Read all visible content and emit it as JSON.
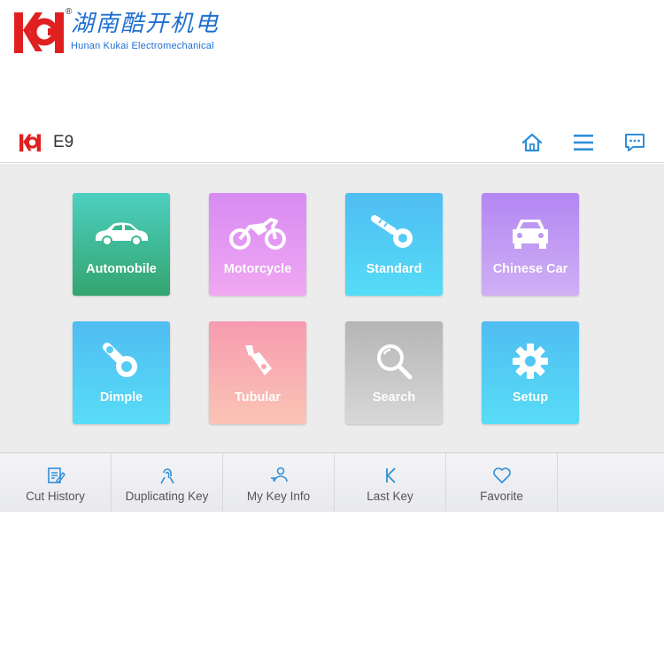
{
  "brand": {
    "name_cn": "湖南酷开机电",
    "name_en": "Hunan Kukai Electromechanical",
    "registered": "®"
  },
  "header": {
    "title": "E9",
    "icons": [
      "home-icon",
      "menu-icon",
      "message-icon"
    ],
    "accent_color": "#2f8fd8"
  },
  "tiles": [
    {
      "label": "Automobile",
      "icon": "car-side-icon"
    },
    {
      "label": "Motorcycle",
      "icon": "motorcycle-icon"
    },
    {
      "label": "Standard",
      "icon": "standard-key-icon"
    },
    {
      "label": "Chinese Car",
      "icon": "car-front-icon"
    },
    {
      "label": "Dimple",
      "icon": "dimple-key-icon"
    },
    {
      "label": "Tubular",
      "icon": "tubular-key-icon"
    },
    {
      "label": "Search",
      "icon": "magnifier-icon"
    },
    {
      "label": "Setup",
      "icon": "gear-icon"
    }
  ],
  "bottom_nav": [
    {
      "label": "Cut History",
      "icon": "edit-note-icon"
    },
    {
      "label": "Duplicating Key",
      "icon": "fingerprint-hand-icon"
    },
    {
      "label": "My Key Info",
      "icon": "user-key-icon"
    },
    {
      "label": "Last Key",
      "icon": "k-letter-icon"
    },
    {
      "label": "Favorite",
      "icon": "heart-icon"
    }
  ]
}
